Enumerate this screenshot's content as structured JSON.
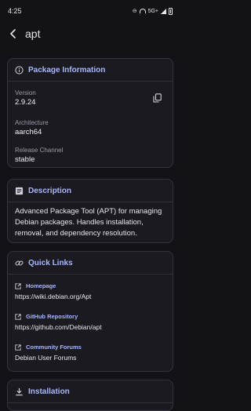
{
  "status": {
    "time": "4:25",
    "network": "5G+"
  },
  "appbar": {
    "title": "apt"
  },
  "package_info": {
    "title": "Package Information",
    "version_label": "Version",
    "version_value": "2.9.24",
    "arch_label": "Architecture",
    "arch_value": "aarch64",
    "channel_label": "Release Channel",
    "channel_value": "stable"
  },
  "description": {
    "title": "Description",
    "text": "Advanced Package Tool (APT) for managing Debian packages. Handles installation, removal, and dependency resolution."
  },
  "quick_links": {
    "title": "Quick Links",
    "items": [
      {
        "label": "Homepage",
        "value": "https://wiki.debian.org/Apt"
      },
      {
        "label": "GitHub Repository",
        "value": "https://github.com/Debian/apt"
      },
      {
        "label": "Community Forums",
        "value": "Debian User Forums"
      }
    ]
  },
  "installation": {
    "title": "Installation"
  },
  "colors": {
    "accent": "#a9b6ff",
    "background": "#121217",
    "card": "#1a1a20"
  }
}
